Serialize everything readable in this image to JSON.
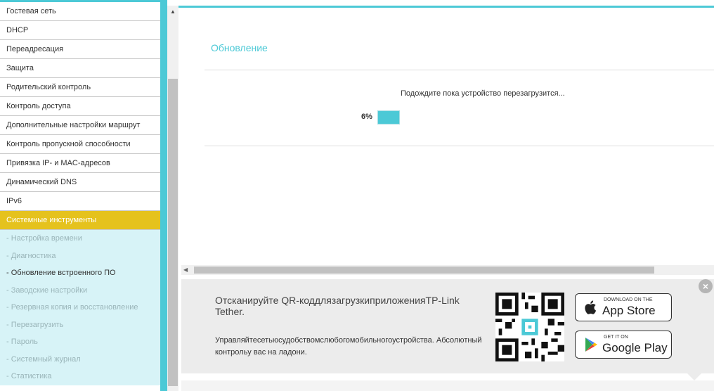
{
  "sidebar": {
    "items": [
      "Гостевая сеть",
      "DHCP",
      "Переадресация",
      "Защита",
      "Родительский контроль",
      "Контроль доступа",
      "Дополнительные настройки маршрут",
      "Контроль пропускной способности",
      "Привязка IP- и MAC-адресов",
      "Динамический DNS",
      "IPv6"
    ],
    "active": "Системные инструменты",
    "sub": [
      "- Настройка времени",
      "- Диагностика",
      "- Обновление встроенного ПО",
      "- Заводские настройки",
      "- Резервная копия и восстановление",
      "- Перезагрузить",
      "- Пароль",
      "- Системный журнал",
      "- Статистика"
    ]
  },
  "main": {
    "title": "Обновление",
    "wait_message": "Подождите пока устройство перезагрузится...",
    "progress_label": "6%",
    "progress": 0.06
  },
  "banner": {
    "heading": "Отсканируйте QR-коддлязагрузкиприложенияTP-Link Tether.",
    "text": "Управляйтесетьюсудобствомслюбогомобильногоустройства. Абсолютный контрольу вас на ладони.",
    "appstore_small": "DOWNLOAD ON THE",
    "appstore_big": "App Store",
    "gplay_small": "GET IT ON",
    "gplay_big": "Google Play"
  },
  "colors": {
    "accent": "#4cc9d6",
    "active": "#e5c21d",
    "submenu_bg": "#d7f3f7"
  },
  "icons": [
    "scroll-up-icon",
    "scroll-left-icon",
    "qr-code-icon",
    "apple-icon",
    "google-play-icon",
    "close-icon"
  ]
}
